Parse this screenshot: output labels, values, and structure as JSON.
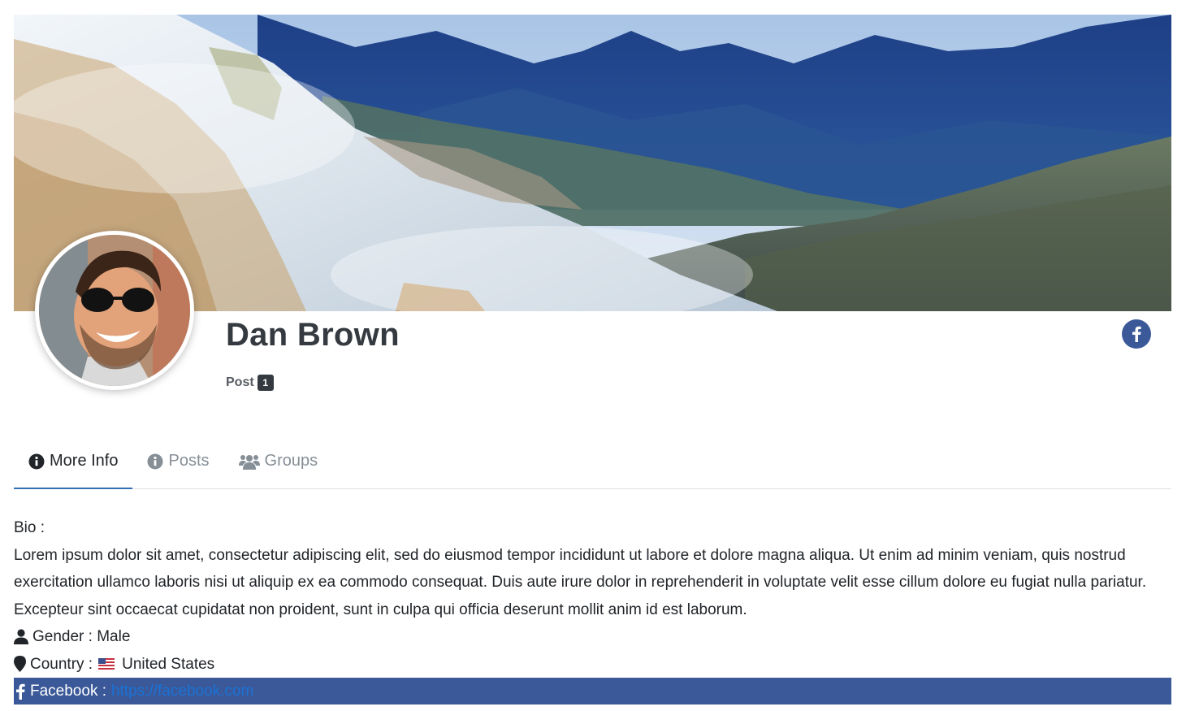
{
  "profile": {
    "name": "Dan Brown",
    "post_label": "Post",
    "post_count": "1"
  },
  "tabs": [
    {
      "label": "More Info",
      "icon": "info-circle-icon",
      "active": true
    },
    {
      "label": "Posts",
      "icon": "info-circle-icon",
      "active": false
    },
    {
      "label": "Groups",
      "icon": "users-icon",
      "active": false
    }
  ],
  "info": {
    "bio_label": "Bio :",
    "bio_text": "Lorem ipsum dolor sit amet, consectetur adipiscing elit, sed do eiusmod tempor incididunt ut labore et dolore magna aliqua. Ut enim ad minim veniam, quis nostrud exercitation ullamco laboris nisi ut aliquip ex ea commodo consequat. Duis aute irure dolor in reprehenderit in voluptate velit esse cillum dolore eu fugiat nulla pariatur. Excepteur sint occaecat cupidatat non proident, sunt in culpa qui officia deserunt mollit anim id est laborum.",
    "gender_label": "Gender : Male",
    "country_label": "Country :",
    "country_value": "United States",
    "facebook_label": "Facebook :",
    "facebook_url": "https://facebook.com"
  },
  "colors": {
    "facebook_blue": "#3b5998",
    "tab_active_underline": "#2f6fb5",
    "link": "#1a72d6"
  }
}
